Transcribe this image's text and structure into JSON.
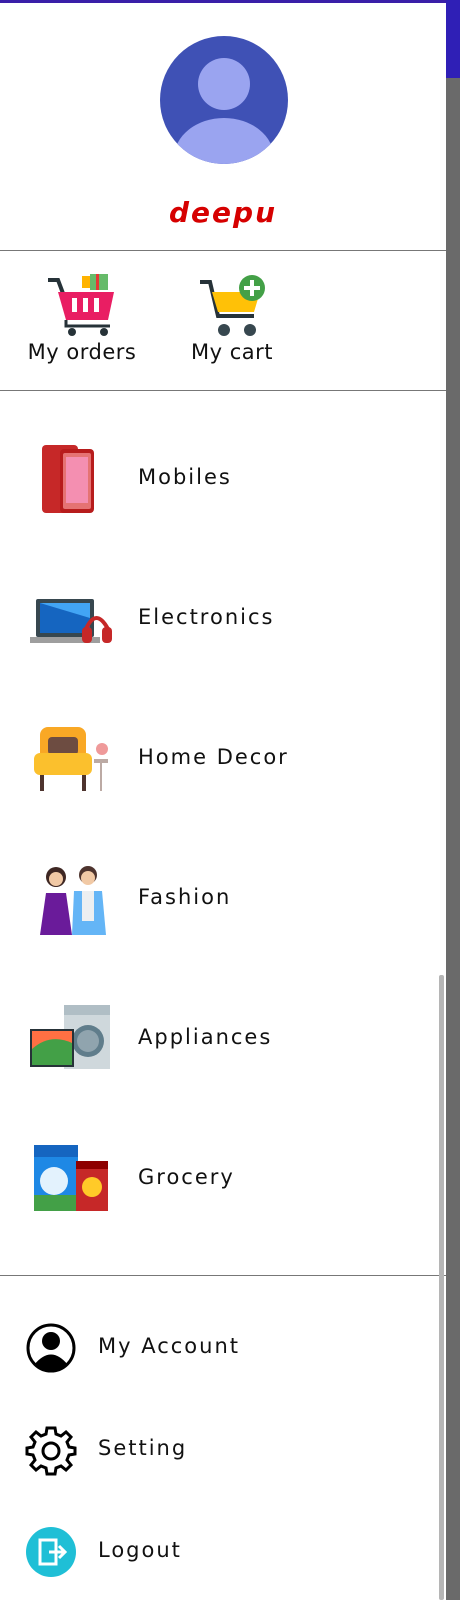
{
  "user": {
    "name": "deepu"
  },
  "quick_actions": [
    {
      "label": "My orders",
      "icon": "shopping-basket-icon"
    },
    {
      "label": "My cart",
      "icon": "cart-add-icon"
    }
  ],
  "categories": [
    {
      "label": "Mobiles",
      "icon": "mobile-phone-icon"
    },
    {
      "label": "Electronics",
      "icon": "laptop-headphones-icon"
    },
    {
      "label": "Home Decor",
      "icon": "armchair-icon"
    },
    {
      "label": "Fashion",
      "icon": "fashion-couple-icon"
    },
    {
      "label": "Appliances",
      "icon": "tv-washer-icon"
    },
    {
      "label": "Grocery",
      "icon": "grocery-pack-icon"
    }
  ],
  "bottom_menu": [
    {
      "label": "My Account",
      "icon": "account-circle-icon"
    },
    {
      "label": "Setting",
      "icon": "gear-icon"
    },
    {
      "label": "Logout",
      "icon": "logout-icon"
    }
  ],
  "colors": {
    "accent": "#3f51b5",
    "username": "#d60000",
    "logout": "#1fbfd6"
  }
}
